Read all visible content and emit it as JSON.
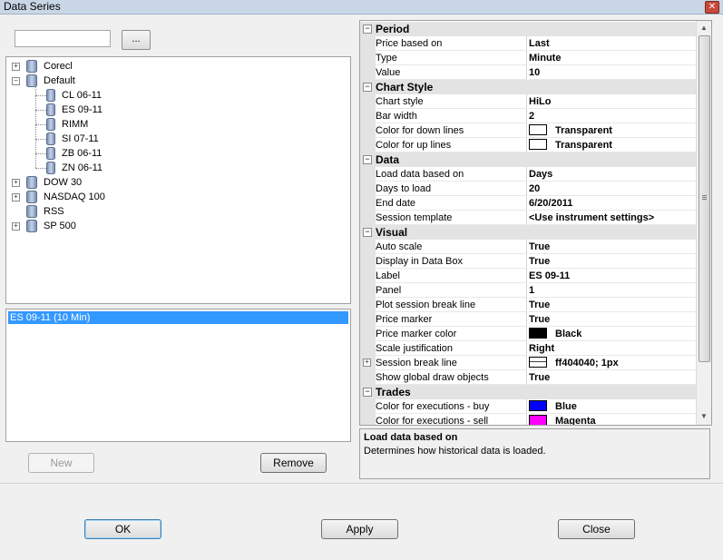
{
  "window": {
    "title": "Data Series",
    "close_glyph": "✕"
  },
  "left": {
    "search_value": "",
    "browse_label": "...",
    "tree": [
      {
        "label": "Corecl",
        "level": 0,
        "expander": "+"
      },
      {
        "label": "Default",
        "level": 0,
        "expander": "−"
      },
      {
        "label": "CL 06-11",
        "level": 1
      },
      {
        "label": "ES 09-11",
        "level": 1
      },
      {
        "label": "RIMM",
        "level": 1
      },
      {
        "label": "SI 07-11",
        "level": 1
      },
      {
        "label": "ZB 06-11",
        "level": 1
      },
      {
        "label": "ZN 06-11",
        "level": 1
      },
      {
        "label": "DOW 30",
        "level": 0,
        "expander": "+"
      },
      {
        "label": "NASDAQ 100",
        "level": 0,
        "expander": "+"
      },
      {
        "label": "RSS",
        "level": 0
      },
      {
        "label": "SP 500",
        "level": 0,
        "expander": "+"
      }
    ],
    "selected_series": "ES 09-11 (10 Min)",
    "new_label": "New",
    "remove_label": "Remove"
  },
  "grid": {
    "rows": [
      {
        "type": "cat",
        "label": "Period"
      },
      {
        "type": "prop",
        "name": "Price based on",
        "value": "Last"
      },
      {
        "type": "prop",
        "name": "Type",
        "value": "Minute"
      },
      {
        "type": "prop",
        "name": "Value",
        "value": "10"
      },
      {
        "type": "cat",
        "label": "Chart Style"
      },
      {
        "type": "prop",
        "name": "Chart style",
        "value": "HiLo"
      },
      {
        "type": "prop",
        "name": "Bar width",
        "value": "2"
      },
      {
        "type": "prop",
        "name": "Color for down lines",
        "value": "Transparent",
        "swatch": "#ffffff"
      },
      {
        "type": "prop",
        "name": "Color for up lines",
        "value": "Transparent",
        "swatch": "#ffffff"
      },
      {
        "type": "cat",
        "label": "Data"
      },
      {
        "type": "prop",
        "name": "Load data based on",
        "value": "Days"
      },
      {
        "type": "prop",
        "name": "Days to load",
        "value": "20"
      },
      {
        "type": "prop",
        "name": "End date",
        "value": "6/20/2011"
      },
      {
        "type": "prop",
        "name": "Session template",
        "value": "<Use instrument settings>"
      },
      {
        "type": "cat",
        "label": "Visual"
      },
      {
        "type": "prop",
        "name": "Auto scale",
        "value": "True"
      },
      {
        "type": "prop",
        "name": "Display in Data Box",
        "value": "True"
      },
      {
        "type": "prop",
        "name": "Label",
        "value": "ES 09-11"
      },
      {
        "type": "prop",
        "name": "Panel",
        "value": "1"
      },
      {
        "type": "prop",
        "name": "Plot session break line",
        "value": "True"
      },
      {
        "type": "prop",
        "name": "Price marker",
        "value": "True"
      },
      {
        "type": "prop",
        "name": "Price marker color",
        "value": "Black",
        "swatch": "#000000"
      },
      {
        "type": "prop",
        "name": "Scale justification",
        "value": "Right"
      },
      {
        "type": "prop",
        "name": "Session break line",
        "value": "ff404040; 1px",
        "swatch": "line",
        "expander": "+"
      },
      {
        "type": "prop",
        "name": "Show global draw objects",
        "value": "True"
      },
      {
        "type": "cat",
        "label": "Trades"
      },
      {
        "type": "prop",
        "name": "Color for executions - buy",
        "value": "Blue",
        "swatch": "#0000ff"
      },
      {
        "type": "prop",
        "name": "Color for executions - sell",
        "value": "Magenta",
        "swatch": "#ff00ff"
      }
    ]
  },
  "help": {
    "title": "Load data based on",
    "description": "Determines how historical data is loaded."
  },
  "footer": {
    "ok_label": "OK",
    "apply_label": "Apply",
    "close_label": "Close"
  }
}
